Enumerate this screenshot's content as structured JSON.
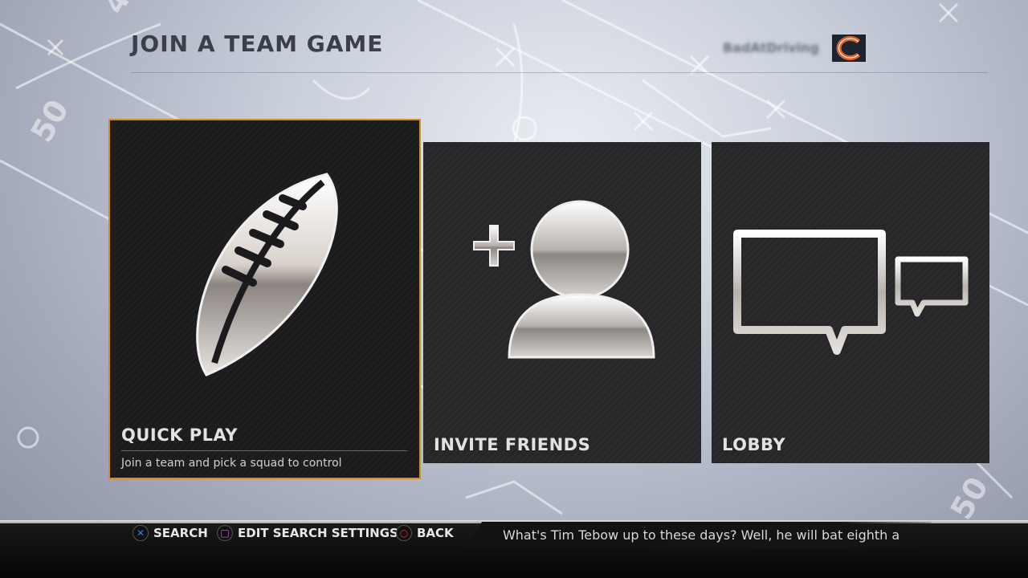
{
  "header": {
    "title": "JOIN A TEAM GAME",
    "username": "BadAtDriving"
  },
  "tiles": [
    {
      "label": "QUICK PLAY",
      "description": "Join a team and pick a squad to control",
      "icon": "football-icon",
      "selected": true
    },
    {
      "label": "INVITE FRIENDS",
      "description": "",
      "icon": "add-friend-icon",
      "selected": false
    },
    {
      "label": "LOBBY",
      "description": "",
      "icon": "chat-bubbles-icon",
      "selected": false
    }
  ],
  "footer": {
    "hints": [
      {
        "button": "cross",
        "label": "SEARCH",
        "color": "#3d7fd8"
      },
      {
        "button": "square",
        "label": "EDIT SEARCH SETTINGS",
        "color": "#c85fd0"
      },
      {
        "button": "circle",
        "label": "BACK",
        "color": "#e0303a"
      }
    ],
    "ticker": "What's Tim Tebow up to these days? Well, he will bat eighth a"
  },
  "colors": {
    "accent": "#d98d1e",
    "team_orange": "#e0642a",
    "team_navy": "#1d2430"
  }
}
